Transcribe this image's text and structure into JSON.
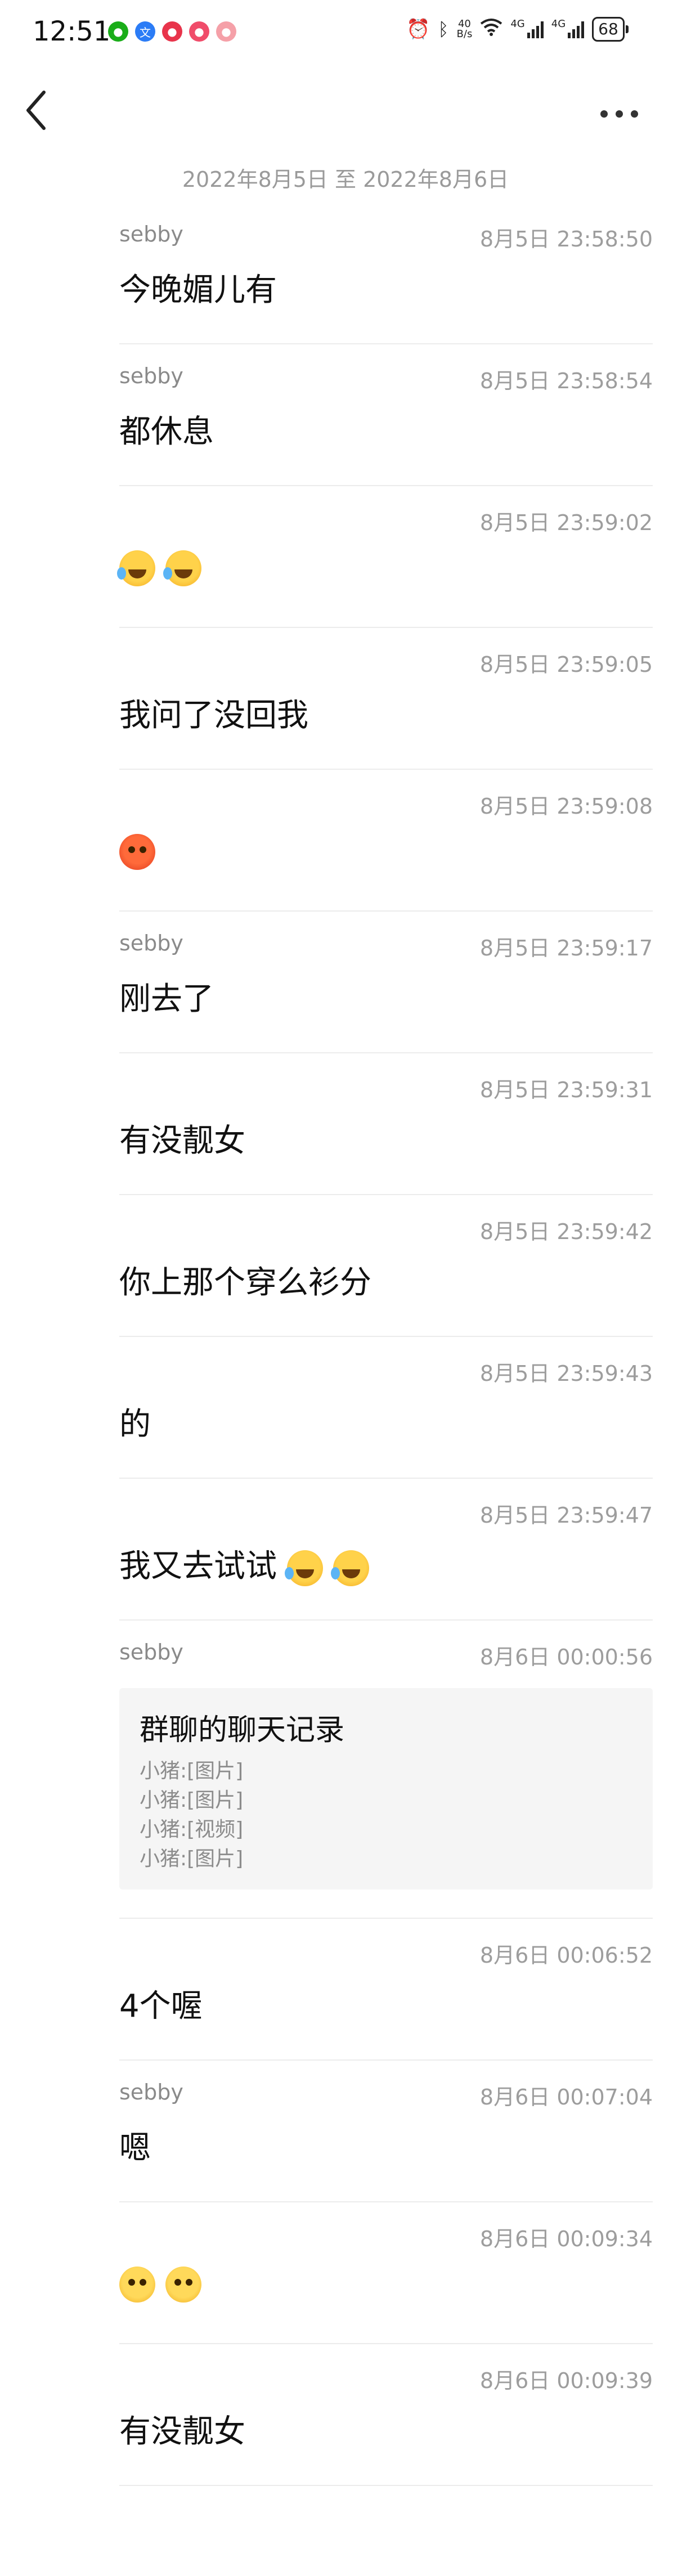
{
  "status_bar": {
    "time": "12:51",
    "net_speed_top": "40",
    "net_speed_bottom": "B/s",
    "net1": "4G",
    "net2": "4G",
    "battery": "68",
    "colors": {
      "wechat": "#1aad19",
      "app2": "#2b7cf6",
      "app3": "#e8344b",
      "app4": "#f04c6a",
      "app5": "#f5a0a8"
    }
  },
  "header": {
    "back_icon": "chevron-left-icon",
    "more_icon": "more-icon"
  },
  "date_range": "2022年8月5日 至 2022年8月6日",
  "messages": [
    {
      "sender": "sebby",
      "time": "8月5日 23:58:50",
      "text": "今晚媚儿有"
    },
    {
      "sender": "sebby",
      "time": "8月5日 23:58:54",
      "text": "都休息"
    },
    {
      "sender": "",
      "time": "8月5日 23:59:02",
      "text": ""
    },
    {
      "sender": "",
      "time": "8月5日 23:59:05",
      "text": "我问了没回我"
    },
    {
      "sender": "",
      "time": "8月5日 23:59:08",
      "text": ""
    },
    {
      "sender": "sebby",
      "time": "8月5日 23:59:17",
      "text": "刚去了"
    },
    {
      "sender": "",
      "time": "8月5日 23:59:31",
      "text": "有没靓女"
    },
    {
      "sender": "",
      "time": "8月5日 23:59:42",
      "text": "你上那个穿么衫分"
    },
    {
      "sender": "",
      "time": "8月5日 23:59:43",
      "text": "的"
    },
    {
      "sender": "",
      "time": "8月5日 23:59:47",
      "text": "我又去试试"
    },
    {
      "sender": "sebby",
      "time": "8月6日 00:00:56",
      "text": ""
    },
    {
      "sender": "",
      "time": "8月6日 00:06:52",
      "text": "4个喔"
    },
    {
      "sender": "sebby",
      "time": "8月6日 00:07:04",
      "text": "嗯"
    },
    {
      "sender": "",
      "time": "8月6日 00:09:34",
      "text": ""
    },
    {
      "sender": "",
      "time": "8月6日 00:09:39",
      "text": "有没靓女"
    }
  ],
  "chat_record": {
    "title": "群聊的聊天记录",
    "lines": [
      "小猪:[图片]",
      "小猪:[图片]",
      "小猪:[视频]",
      "小猪:[图片]"
    ]
  }
}
